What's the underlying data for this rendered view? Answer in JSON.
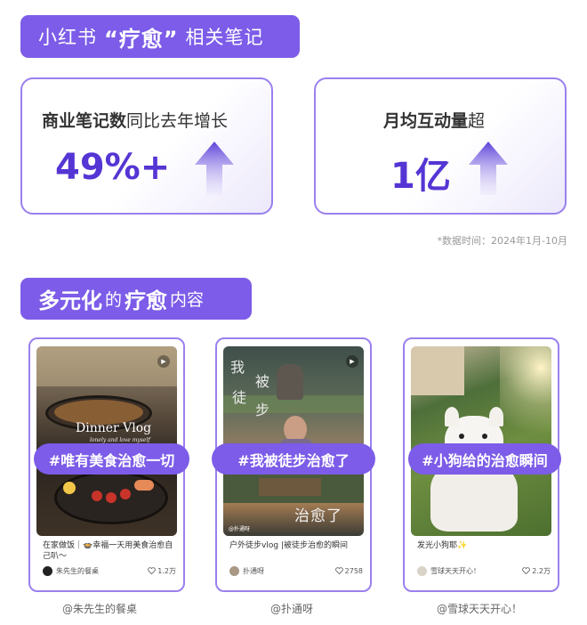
{
  "section1": {
    "prefix": "小红书",
    "highlight": "“疗愈”",
    "suffix": "相关笔记"
  },
  "stats": [
    {
      "label_bold": "商业笔记数",
      "label_rest": "同比去年增长",
      "value": "49%+"
    },
    {
      "label_bold": "月均互动量",
      "label_rest": "超",
      "value": "1亿"
    }
  ],
  "note": "*数据时间：2024年1月-10月",
  "section2": {
    "part1": "多元化",
    "part2": "的",
    "part3": "疗愈",
    "part4": "内容"
  },
  "cards": [
    {
      "hashtag": "#唯有美食治愈一切",
      "overlay_title": "Dinner Vlog",
      "overlay_sub": "lonely and love myself",
      "caption": "在家做饭｜🍲幸福一天用美食治愈自己叭～",
      "author": "朱先生的餐桌",
      "likes": "1.2万",
      "source": "@朱先生的餐桌"
    },
    {
      "hashtag": "#我被徒步治愈了",
      "overlay_chars": [
        "我",
        "被",
        "徒",
        "步"
      ],
      "overlay_bottom": "治愈了",
      "overlay_tag": "@扑通呀",
      "caption": "户外徒步vlog |被徒步治愈的瞬间",
      "author": "扑通呀",
      "likes": "2758",
      "source": "@扑通呀"
    },
    {
      "hashtag": "#小狗给的治愈瞬间",
      "caption": "发光小狗耶✨",
      "author": "雪球天天开心！",
      "likes": "2.2万",
      "source": "@雪球天天开心！"
    }
  ],
  "colors": {
    "accent": "#7c5ce8",
    "accent_dark": "#5535d4",
    "card_border": "#9b80ee"
  },
  "icons": [
    "up-arrow-icon",
    "heart-icon",
    "play-icon"
  ]
}
